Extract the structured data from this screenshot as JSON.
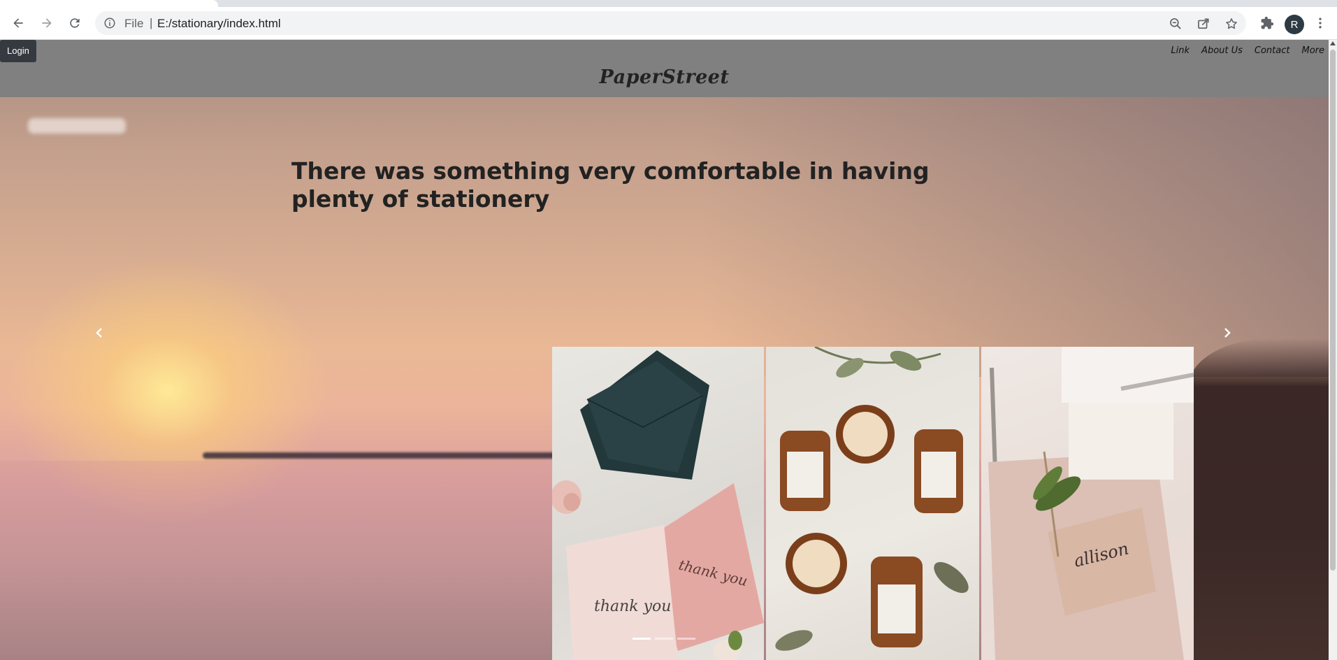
{
  "browser": {
    "scheme": "File",
    "url": "E:/stationary/index.html",
    "profile_initial": "R",
    "icons": [
      "back-icon",
      "forward-icon",
      "reload-icon",
      "site-info-icon",
      "zoom-out-icon",
      "share-icon",
      "bookmark-star-icon",
      "extensions-icon",
      "menu-dots-icon"
    ]
  },
  "header": {
    "login_label": "Login",
    "nav": [
      "Link",
      "About Us",
      "Contact",
      "More"
    ],
    "brand": "PaperStreet",
    "background": "#808080"
  },
  "hero": {
    "heading": "There was something very comfortable in having plenty of stationery",
    "prev_icon": "chevron-left-icon",
    "next_icon": "chevron-right-icon",
    "slides": 3,
    "active_slide": 1,
    "cards": [
      {
        "name": "thank-you-cards",
        "text_1": "thank you",
        "text_2": "thank you"
      },
      {
        "name": "candle-jars"
      },
      {
        "name": "place-card",
        "text": "allison"
      }
    ]
  }
}
